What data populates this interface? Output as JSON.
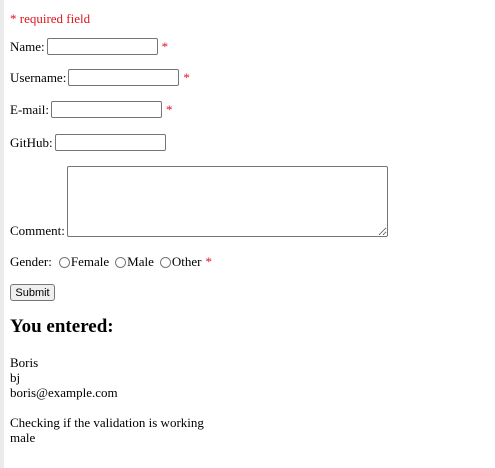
{
  "required_note": "* required field",
  "form": {
    "name": {
      "label": "Name:",
      "value": "",
      "required_mark": "*"
    },
    "username": {
      "label": "Username:",
      "value": "",
      "required_mark": "*"
    },
    "email": {
      "label": "E-mail:",
      "value": "",
      "required_mark": "*"
    },
    "github": {
      "label": "GitHub:",
      "value": ""
    },
    "comment": {
      "label": "Comment:",
      "value": ""
    },
    "gender": {
      "label": "Gender:",
      "options": [
        "Female",
        "Male",
        "Other"
      ],
      "required_mark": "*"
    },
    "submit_label": "Submit"
  },
  "result": {
    "heading": "You entered:",
    "lines": [
      "Boris",
      "bj",
      "boris@example.com",
      "",
      "Checking if the validation is working",
      "male"
    ]
  },
  "colors": {
    "required": "#e0141e"
  }
}
